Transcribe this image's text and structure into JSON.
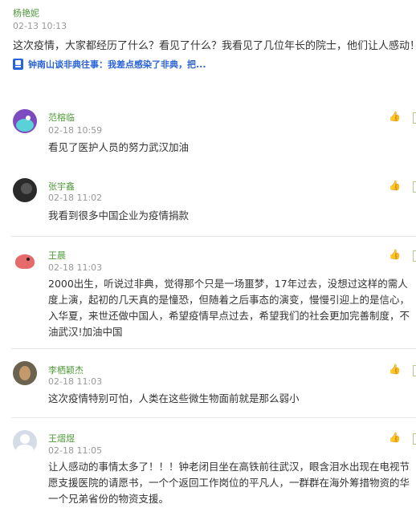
{
  "post": {
    "author": "杨艳妮",
    "time": "02-13 10:13",
    "content": "这次疫情，大家都经历了什么？看见了什么？我看见了几位年长的院士，他们让人感动！",
    "link_text": "钟南山谈非典往事：我差点感染了非典，把..."
  },
  "comments": [
    {
      "name": "范榕临",
      "time": "02-18 10:59",
      "avatar_icon": "monster-avatar",
      "lines": [
        "看见了医护人员的努力武汉加油"
      ]
    },
    {
      "name": "张宇鑫",
      "time": "02-18 11:02",
      "avatar_icon": "dark-avatar",
      "lines": [
        "我看到很多中国企业为疫情捐款"
      ]
    },
    {
      "name": "王晨",
      "time": "02-18 11:03",
      "avatar_icon": "bird-avatar",
      "lines": [
        "2000出生，听说过非典，觉得那个只是一场噩梦，17年过去，没想过这样的需人",
        "度上演，起初的几天真的是憧恐，但随着之后事态的演变，慢慢引迎上的是信心，",
        "入华夏，来世还做中国人，希望疫情早点过去，希望我们的社会更加完善制度，不",
        "油武汉!加油中国"
      ]
    },
    {
      "name": "李栖颖杰",
      "time": "02-18 11:03",
      "avatar_icon": "face-avatar",
      "lines": [
        "这次疫情特别可怕，人类在这些微生物面前就是那么弱小"
      ]
    },
    {
      "name": "王熠煜",
      "time": "02-18 11:05",
      "avatar_icon": "default-avatar",
      "lines": [
        "让人感动的事情太多了！！！钟老闭目坐在高铁前往武汉，眼含泪水出现在电视节",
        "愿支援医院的请愿书，一个个返回工作岗位的平凡人，一群群在海外筹措物资的华",
        "一个兄弟省份的物资支援。"
      ]
    }
  ]
}
